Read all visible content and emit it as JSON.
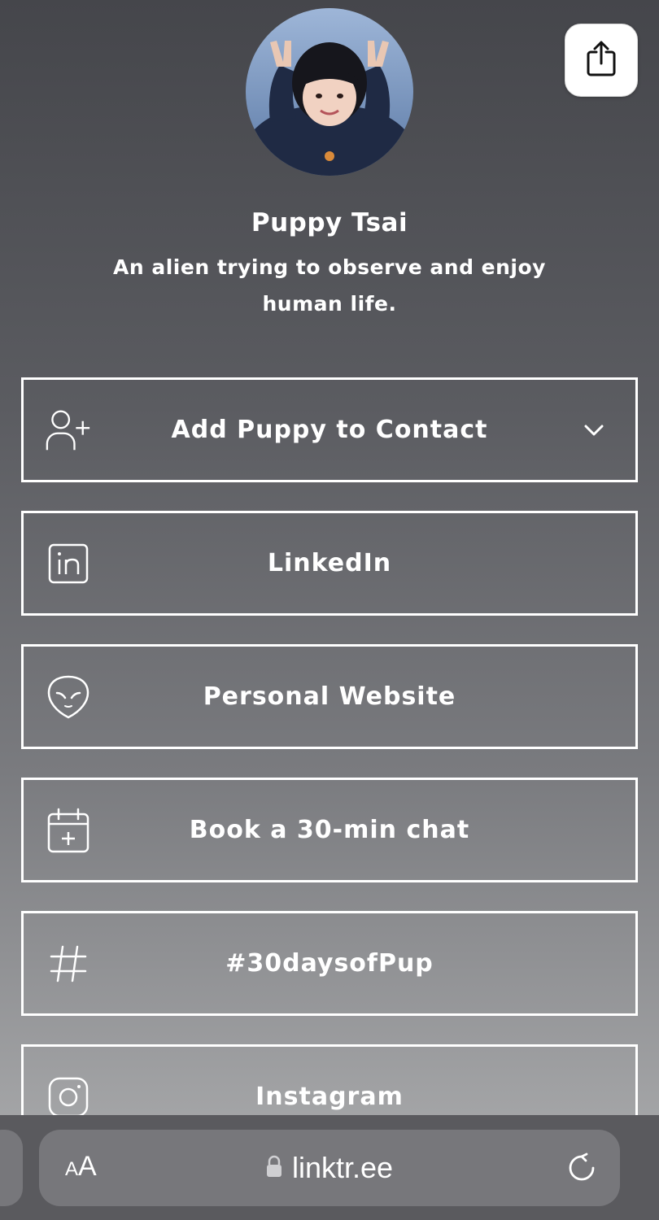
{
  "profile": {
    "name": "Puppy Tsai",
    "bio": "An alien trying to observe and enjoy human life."
  },
  "links": [
    {
      "label": "Add Puppy to Contact",
      "icon": "add-contact-icon",
      "has_chevron": true
    },
    {
      "label": "LinkedIn",
      "icon": "linkedin-icon"
    },
    {
      "label": "Personal Website",
      "icon": "alien-face-icon"
    },
    {
      "label": "Book a 30-min chat",
      "icon": "calendar-add-icon"
    },
    {
      "label": "#30daysofPup",
      "icon": "hashtag-icon"
    },
    {
      "label": "Instagram",
      "icon": "instagram-icon"
    }
  ],
  "browser": {
    "text_size_small": "A",
    "text_size_large": "A",
    "url": "linktr.ee"
  },
  "colors": {
    "background_top": "#45464b",
    "background_bottom": "#a3a4a6",
    "button_border": "#ffffff",
    "text": "#ffffff",
    "browser_bar": "#5a5a5e",
    "address_pill": "#77777b"
  }
}
